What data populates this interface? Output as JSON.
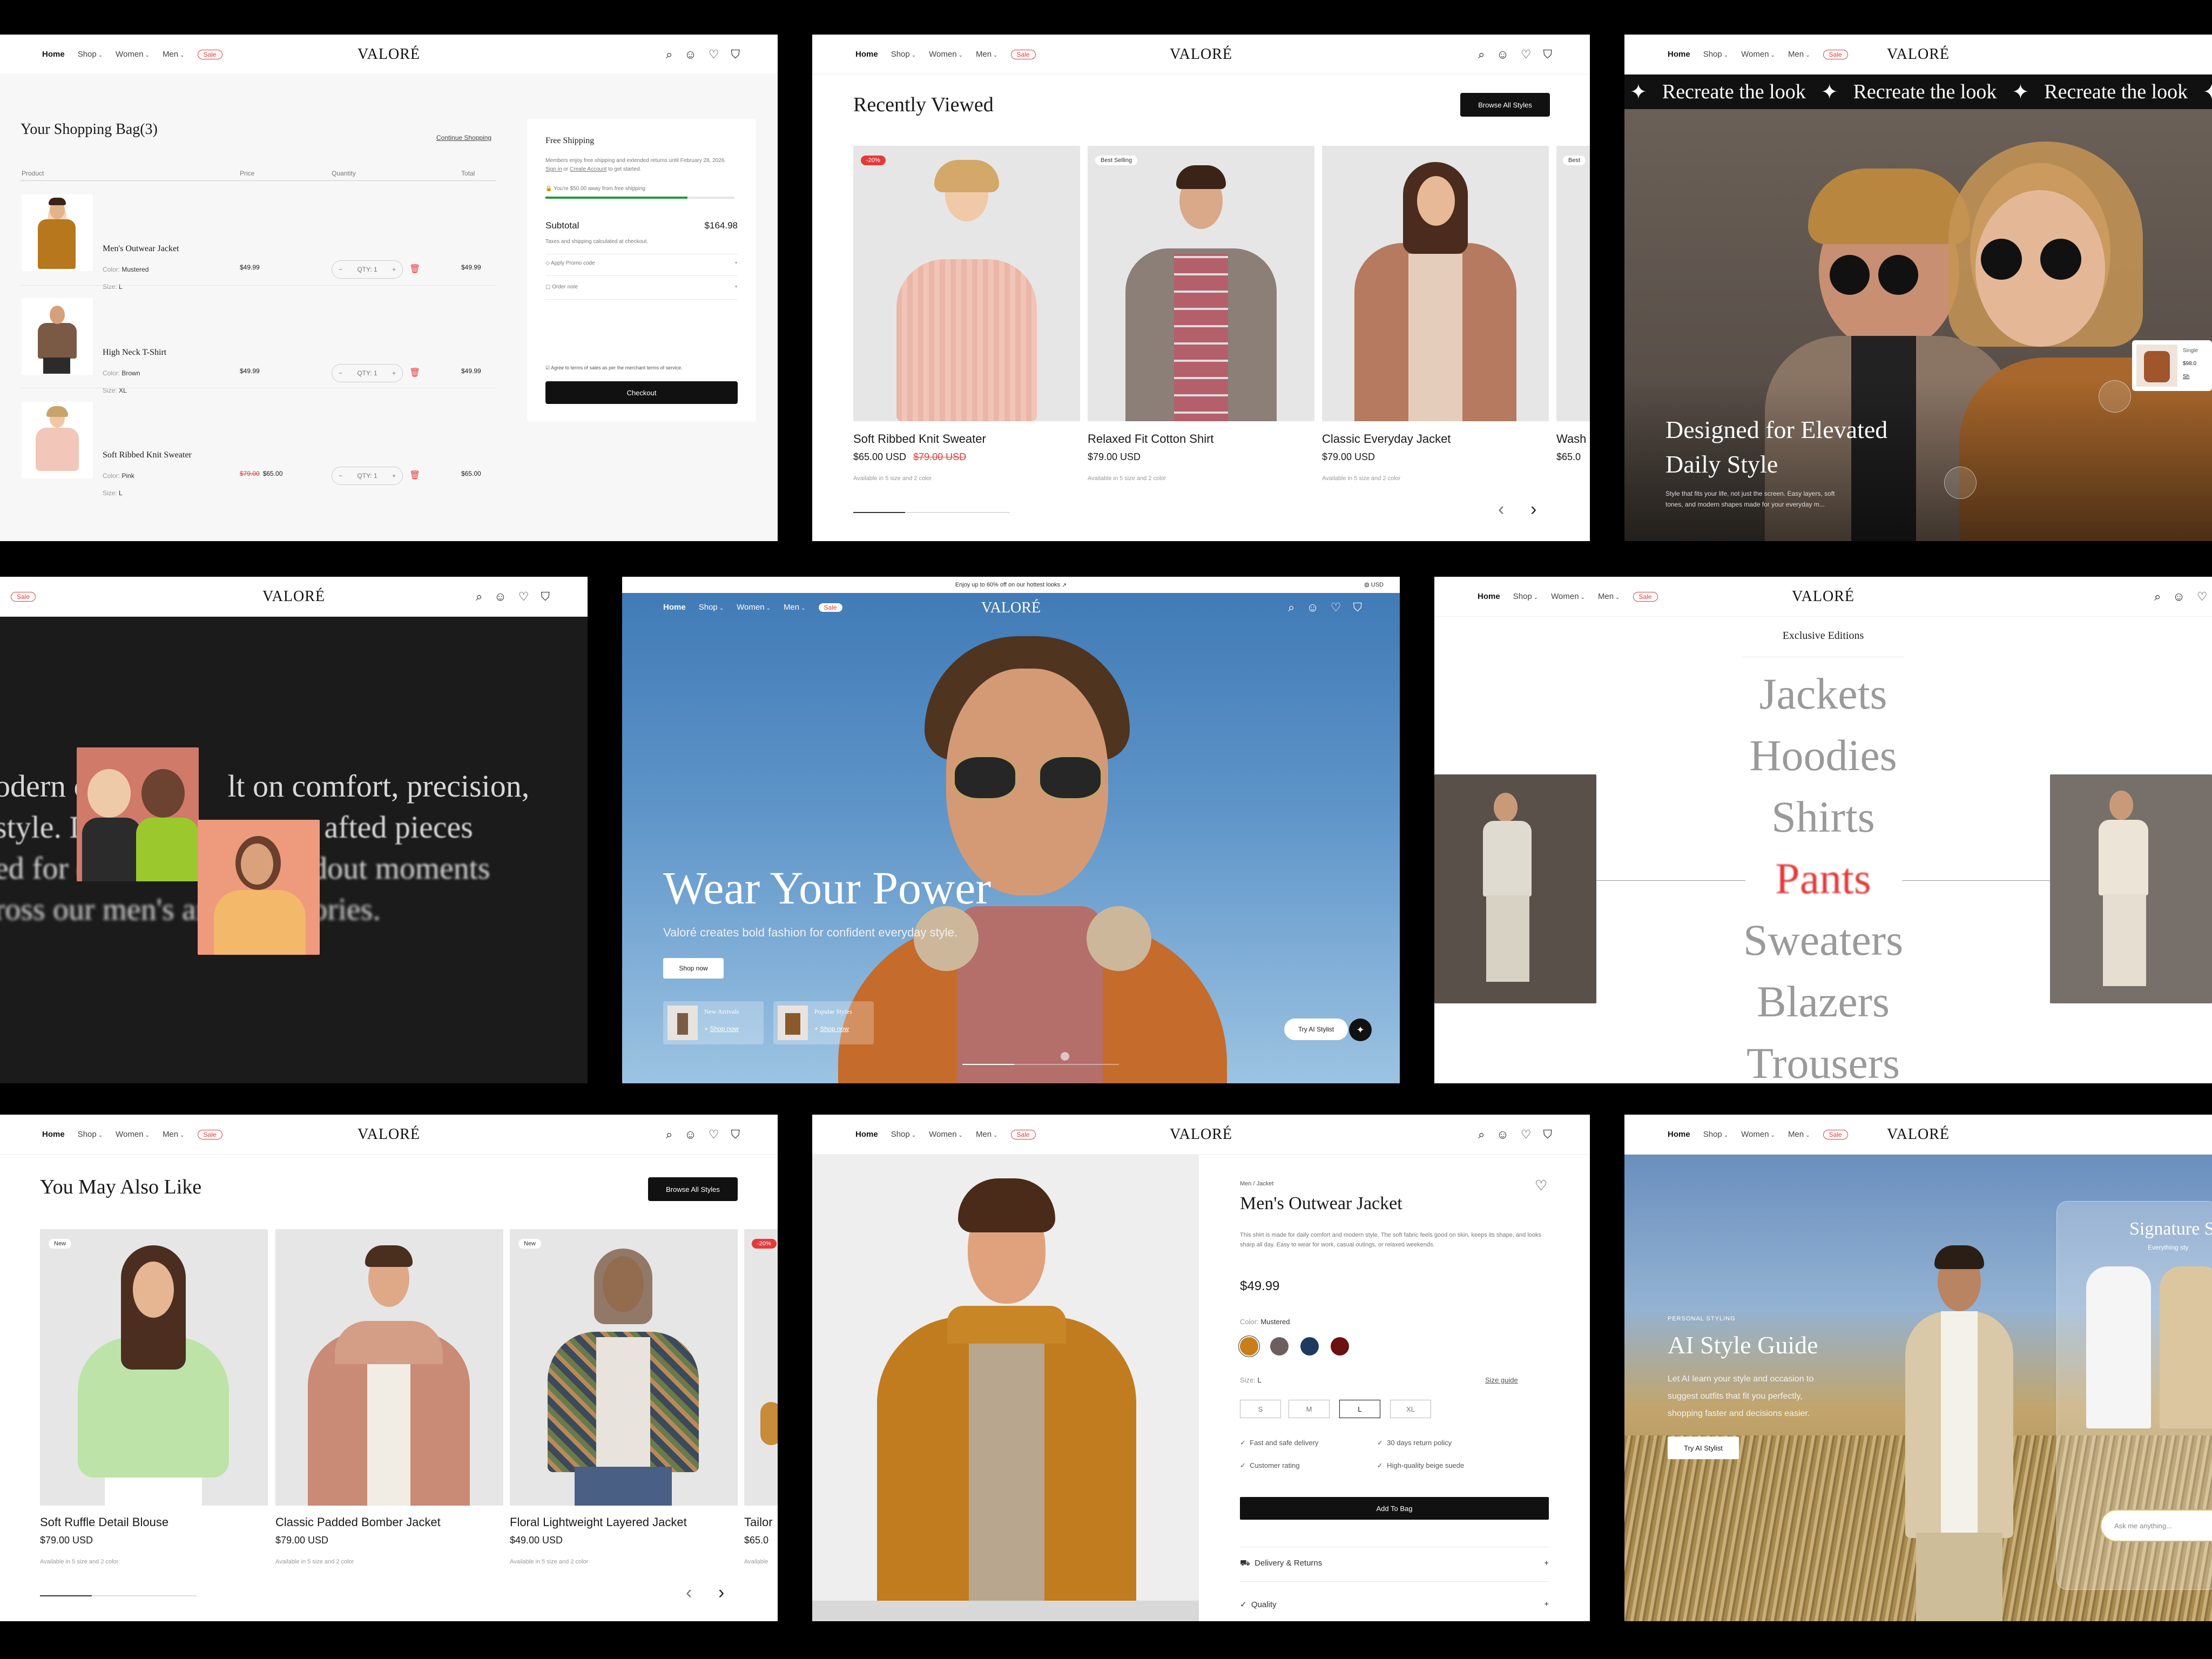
{
  "nav": {
    "home": "Home",
    "shop": "Shop",
    "women": "Women",
    "men": "Men",
    "sale": "Sale",
    "logo": "VALORÉ"
  },
  "cart": {
    "title": "Your Shopping Bag(3)",
    "continue": "Continue Shopping",
    "col_product": "Product",
    "col_price": "Price",
    "col_quantity": "Quantity",
    "col_total": "Total",
    "items": [
      {
        "name": "Men's Outwear Jacket",
        "color_label": "Color:",
        "color": "Mustered",
        "size_label": "Size:",
        "size": "L",
        "price": "$49.99",
        "old_price": "",
        "qty": "QTY: 1",
        "total": "$49.99"
      },
      {
        "name": "High Neck T-Shirt",
        "color_label": "Color:",
        "color": "Brown",
        "size_label": "Size:",
        "size": "XL",
        "price": "$49.99",
        "old_price": "",
        "qty": "QTY: 1",
        "total": "$49.99"
      },
      {
        "name": "Soft Ribbed Knit Sweater",
        "color_label": "Color:",
        "color": "Pink",
        "size_label": "Size:",
        "size": "L",
        "price": "$65.00",
        "old_price": "$79.00",
        "qty": "QTY: 1",
        "total": "$65.00"
      }
    ],
    "summary": {
      "free_title": "Free Shipping",
      "free_text": "Members enjoy free shipping and extended returns until February 28, 2026.",
      "signin": "Sign in",
      "create": "Create Account",
      "free_tail": "to get started.",
      "away": "You're $50.00 away from free shipping",
      "progress": 0.75,
      "subtotal_label": "Subtotal",
      "subtotal": "$164.98",
      "taxes": "Taxes and shipping calculated at checkout.",
      "promo": "Apply Promo code",
      "note": "Order note",
      "agree": "Agree to terms of sales as per the merchant terms of service.",
      "checkout": "Checkout"
    }
  },
  "recent": {
    "title": "Recently Viewed",
    "browse": "Browse All Styles",
    "products": [
      {
        "name": "Soft Ribbed Knit Sweater",
        "price": "$65.00 USD",
        "old": "$79.00 USD",
        "avail": "Available in 5 size and 2 color",
        "badge": "-20%"
      },
      {
        "name": "Relaxed Fit Cotton Shirt",
        "price": "$79.00 USD",
        "old": "",
        "avail": "Available in 5 size and 2 color",
        "badge": "Best Selling"
      },
      {
        "name": "Classic Everyday Jacket",
        "price": "$79.00 USD",
        "old": "",
        "avail": "Available in 5 size and 2 color",
        "badge": ""
      },
      {
        "name": "Wash",
        "price": "$65.0",
        "old": "",
        "avail": "",
        "badge": "Best"
      }
    ]
  },
  "lookbook": {
    "marquee": [
      "Recreate the look",
      "Recreate the look",
      "Recreate the look",
      "R"
    ],
    "title_line1": "Designed for Elevated",
    "title_line2": "Daily Style",
    "desc_line1": "Style that fits your life, not just the screen. Easy layers, soft",
    "desc_line2": "tones, and modern shapes made for your everyday m...",
    "pop_name": "Single",
    "pop_price": "$98.0",
    "pop_link": "Sh"
  },
  "story": {
    "line1": "odern co",
    "line1b": "lt on comfort, precision,",
    "line2": "style. D",
    "line2b": "afted pieces",
    "line3": "ed for e",
    "line3b": "dout moments",
    "line4": "ross our men's and",
    "line4b": "ategories."
  },
  "hero": {
    "promo": "Enjoy up to 60% off on our hottest looks",
    "currency": "USD",
    "title": "Wear Your Power",
    "subtitle": "Valoré creates bold fashion for confident everyday style.",
    "shop_now": "Shop now",
    "card1_title": "New Arrivals",
    "card1_link": "Shop now",
    "card2_title": "Popular Styles",
    "card2_link": "Shop now",
    "stylist": "Try AI Stylist"
  },
  "editions": {
    "title": "Exclusive Editions",
    "categories": [
      "Jackets",
      "Hoodies",
      "Shirts",
      "Pants",
      "Sweaters",
      "Blazers",
      "Trousers"
    ]
  },
  "also": {
    "title": "You May Also Like",
    "browse": "Browse All Styles",
    "products": [
      {
        "name": "Soft Ruffle Detail Blouse",
        "price": "$79.00 USD",
        "avail": "Available in 5 size and 2 color",
        "badge": "New"
      },
      {
        "name": "Classic Padded Bomber Jacket",
        "price": "$79.00 USD",
        "avail": "Available in 5 size and 2 color",
        "badge": ""
      },
      {
        "name": "Floral Lightweight Layered Jacket",
        "price": "$49.00 USD",
        "avail": "Available in 5 size and 2 color",
        "badge": "New"
      },
      {
        "name": "Tailor",
        "price": "$65.0",
        "avail": "Available",
        "badge": "-20%"
      }
    ]
  },
  "pdp": {
    "breadcrumb": "Men / Jacket",
    "title": "Men's Outwear Jacket",
    "desc": "This shirt is made for daily comfort and modern style. The soft fabric feels good on skin, keeps its shape, and looks sharp all day. Easy to wear for work, casual outings, or relaxed weekends.",
    "price": "$49.99",
    "color_label": "Color:",
    "color": "Mustered",
    "swatches": [
      "#c97e1a",
      "#6d5f5f",
      "#1e3a5f",
      "#6a1111"
    ],
    "size_label": "Size:",
    "size": "L",
    "size_guide": "Size guide",
    "sizes": [
      "S",
      "M",
      "L",
      "XL"
    ],
    "features": [
      "Fast and safe delivery",
      "30 days return policy",
      "Customer rating",
      "High-quality beige suede"
    ],
    "add": "Add To Bag",
    "delivery": "Delivery & Returns",
    "quality": "Quality"
  },
  "ai": {
    "eyebrow": "PERSONAL STYLING",
    "title": "AI Style Guide",
    "desc_line1": "Let AI learn your style and occasion to",
    "desc_line2": "suggest outfits that fit you perfectly,",
    "desc_line3": "shopping faster and decisions easier.",
    "cta": "Try AI Stylist",
    "sig_title": "Signature S",
    "sig_sub": "Everything sty",
    "ask": "Ask me anything..."
  }
}
